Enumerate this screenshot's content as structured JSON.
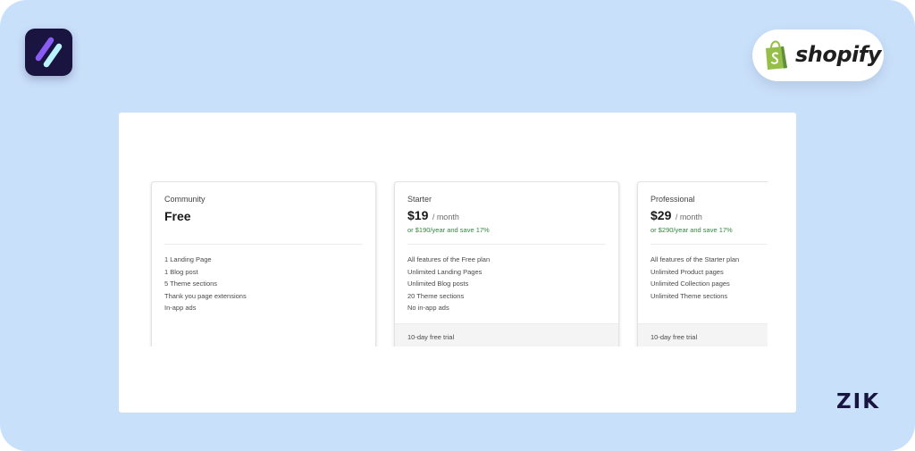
{
  "brand": {
    "app_logo_icon": "slash-stripes-icon",
    "shopify_icon": "shopify-bag-icon",
    "shopify_wordmark": "shopify",
    "watermark": "ZIK"
  },
  "colors": {
    "background": "#c9e0fb",
    "app_logo_bg": "#1a1540",
    "accent_green": "#2f8a3c",
    "shopify_green": "#95bf47"
  },
  "plans": [
    {
      "name": "Community",
      "price": "Free",
      "features": [
        "1 Landing Page",
        "1 Blog post",
        "5 Theme sections",
        "Thank you page extensions",
        "In-app ads"
      ]
    },
    {
      "name": "Starter",
      "price": "$19",
      "price_unit": "/ month",
      "yearly": "or $190/year and save 17%",
      "features": [
        "All features of the Free plan",
        "Unlimited Landing Pages",
        "Unlimited Blog posts",
        "20 Theme sections",
        "No in-app ads"
      ],
      "trial": "10-day free trial"
    },
    {
      "name": "Professional",
      "price": "$29",
      "price_unit": "/ month",
      "yearly": "or $290/year and save 17%",
      "features": [
        "All features of the Starter plan",
        "Unlimited Product pages",
        "Unlimited Collection pages",
        "Unlimited Theme sections"
      ],
      "trial": "10-day free trial"
    }
  ]
}
